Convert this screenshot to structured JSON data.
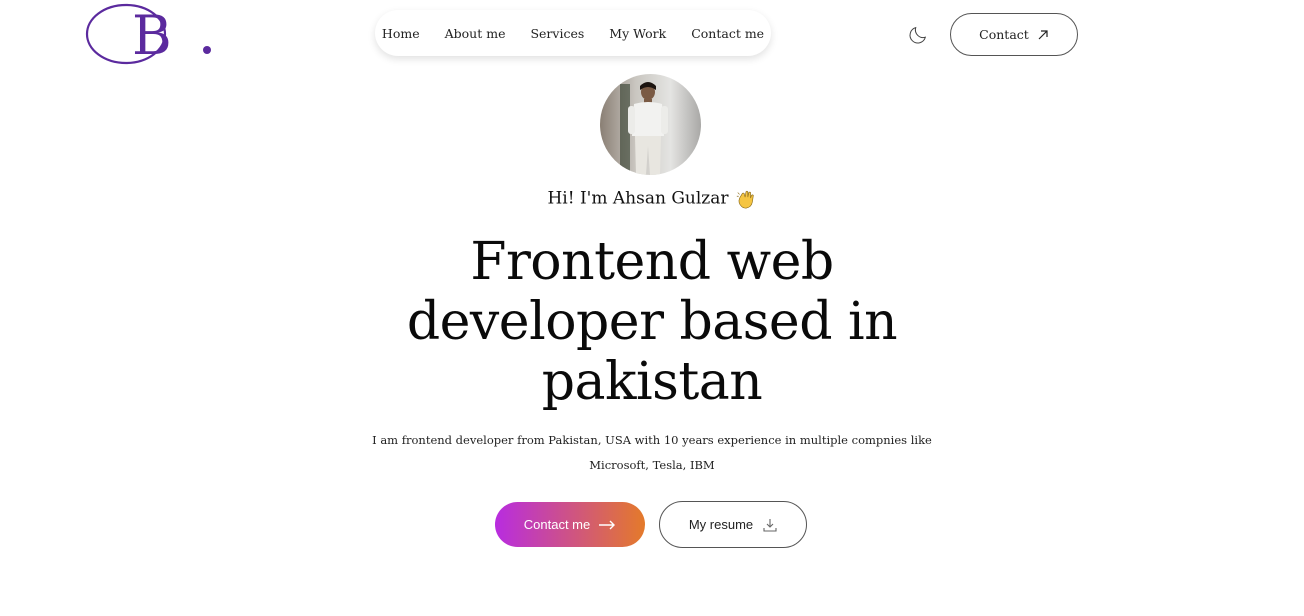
{
  "brand": {
    "letter": "B",
    "accent": "#5b2a9e"
  },
  "nav": {
    "items": [
      {
        "label": "Home"
      },
      {
        "label": "About me"
      },
      {
        "label": "Services"
      },
      {
        "label": "My Work"
      },
      {
        "label": "Contact me"
      }
    ]
  },
  "header": {
    "theme_toggle_icon": "moon-icon",
    "contact_label": "Contact",
    "contact_icon": "arrow-up-right-icon"
  },
  "hero": {
    "greeting": "Hi! I'm Ahsan Gulzar",
    "greeting_icon": "waving-hand-icon",
    "headline_lines": [
      "Frontend web",
      "developer based in",
      "pakistan"
    ],
    "description_lines": [
      "I am frontend developer from Pakistan, USA with 10 years experience in multiple compnies like",
      "Microsoft, Tesla, IBM"
    ],
    "primary_cta": {
      "label": "Contact me",
      "icon": "arrow-right-icon"
    },
    "secondary_cta": {
      "label": "My resume",
      "icon": "download-icon"
    }
  },
  "colors": {
    "gradient_start": "#b82ce0",
    "gradient_end": "#e47a2a"
  }
}
